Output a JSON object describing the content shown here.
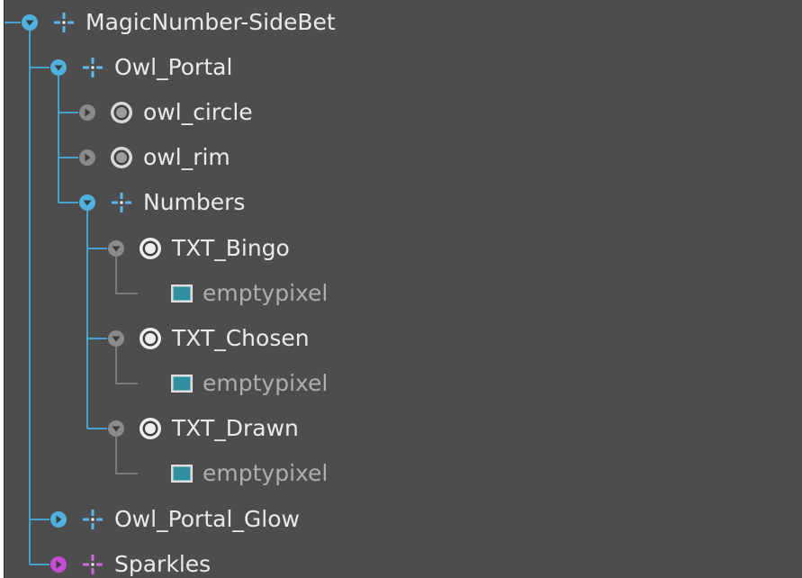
{
  "colors": {
    "background": "#4d4d4d",
    "tree_line_blue": "#45a3cf",
    "tree_line_gray": "#8a8a8a",
    "arrow_blue": "#4fb0dd",
    "arrow_magenta": "#c44bd3",
    "node2d_icon": "#5fb8ea",
    "particles_icon": "#c86ad8",
    "sprite_icon": "#2f8f9f",
    "text": "#eaeaea",
    "text_dim": "#aeaeae"
  },
  "tree": {
    "nodes": [
      {
        "label": "MagicNumber-SideBet",
        "icon": "node2d-icon",
        "arrow": "expanded-blue"
      },
      {
        "label": "Owl_Portal",
        "icon": "node2d-icon",
        "arrow": "expanded-blue"
      },
      {
        "label": "owl_circle",
        "icon": "spine-radio-icon",
        "arrow": "collapsed-gray"
      },
      {
        "label": "owl_rim",
        "icon": "spine-radio-icon",
        "arrow": "collapsed-gray"
      },
      {
        "label": "Numbers",
        "icon": "node2d-icon",
        "arrow": "expanded-blue"
      },
      {
        "label": "TXT_Bingo",
        "icon": "text-radio-icon",
        "arrow": "expanded-gray"
      },
      {
        "label": "emptypixel",
        "icon": "sprite-icon",
        "arrow": "none"
      },
      {
        "label": "TXT_Chosen",
        "icon": "text-radio-icon",
        "arrow": "expanded-gray"
      },
      {
        "label": "emptypixel",
        "icon": "sprite-icon",
        "arrow": "none"
      },
      {
        "label": "TXT_Drawn",
        "icon": "text-radio-icon",
        "arrow": "expanded-gray"
      },
      {
        "label": "emptypixel",
        "icon": "sprite-icon",
        "arrow": "none"
      },
      {
        "label": "Owl_Portal_Glow",
        "icon": "node2d-icon",
        "arrow": "collapsed-blue"
      },
      {
        "label": "Sparkles",
        "icon": "particles-icon",
        "arrow": "collapsed-magenta"
      }
    ]
  }
}
